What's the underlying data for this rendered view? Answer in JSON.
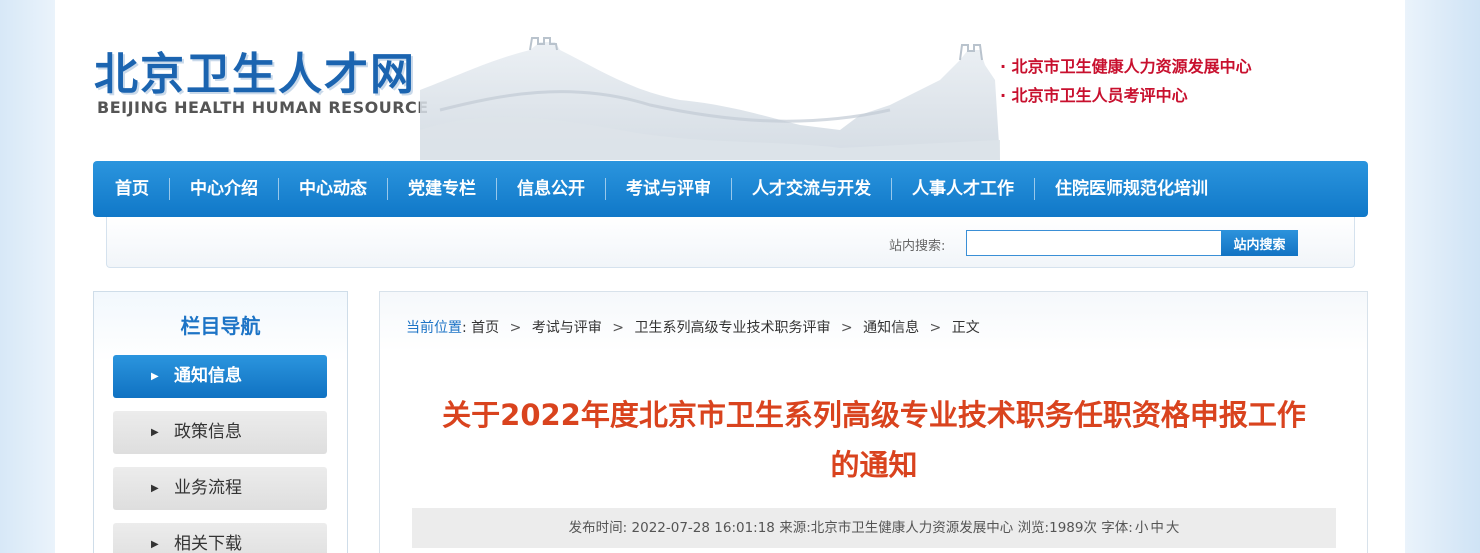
{
  "header": {
    "logo_cn": "北京卫生人才网",
    "logo_en": "BEIJING HEALTH HUMAN RESOURCE",
    "org_links": [
      "· 北京市卫生健康人力资源发展中心",
      "· 北京市卫生人员考评中心"
    ]
  },
  "nav": {
    "items": [
      "首页",
      "中心介绍",
      "中心动态",
      "党建专栏",
      "信息公开",
      "考试与评审",
      "人才交流与开发",
      "人事人才工作",
      "住院医师规范化培训"
    ]
  },
  "search": {
    "label": "站内搜索:",
    "value": "",
    "button": "站内搜索"
  },
  "sidebar": {
    "title": "栏目导航",
    "items": [
      {
        "label": "通知信息",
        "active": true
      },
      {
        "label": "政策信息",
        "active": false
      },
      {
        "label": "业务流程",
        "active": false
      },
      {
        "label": "相关下载",
        "active": false
      }
    ]
  },
  "breadcrumb": {
    "prefix": "当前位置",
    "colon": ":",
    "items": [
      "首页",
      "考试与评审",
      "卫生系列高级专业技术职务评审",
      "通知信息",
      "正文"
    ],
    "separator": ">"
  },
  "article": {
    "title_line1": "关于2022年度北京市卫生系列高级专业技术职务任职资格申报工作",
    "title_line2": "的通知",
    "meta": {
      "publish_label": "发布时间:",
      "publish_time": "2022-07-28 16:01:18",
      "source_label": "来源:",
      "source": "北京市卫生健康人力资源发展中心",
      "views_label": "浏览:",
      "views": "1989次",
      "font_label": "字体:",
      "font_sizes": [
        "小",
        "中",
        "大"
      ]
    }
  },
  "colors": {
    "brand_blue": "#1b64b0",
    "nav_blue": "#1078c8",
    "org_red": "#c8102e",
    "title_red": "#d9431e"
  }
}
